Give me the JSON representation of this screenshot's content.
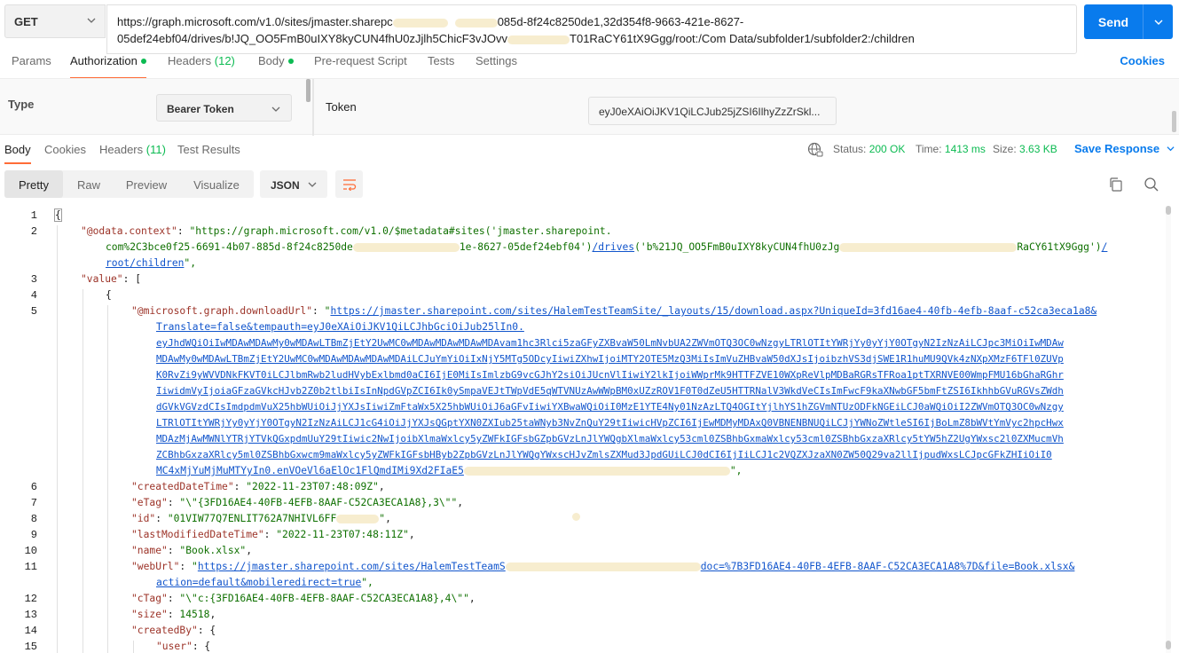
{
  "request": {
    "method": "GET",
    "url_line1": "https://graph.microsoft.com/v1.0/sites/jmaster.sharepc",
    "url_line1_b": "085d-8f24c8250de1,32d354f8-9663-421e-8627-",
    "url_line2": "05def24ebf04/drives/b!JQ_OO5FmB0uIXY8kyCUN4fhU0zJjlh5ChicF3vJOvv",
    "url_line2_b": "T01RaCY61tX9Ggg/root:/Com Data/subfolder1/subfolder2:/children",
    "send_label": "Send"
  },
  "request_tabs": {
    "params": "Params",
    "authorization": "Authorization",
    "headers": "Headers",
    "headers_count": "(12)",
    "body": "Body",
    "prerequest": "Pre-request Script",
    "tests": "Tests",
    "settings": "Settings",
    "cookies": "Cookies"
  },
  "auth": {
    "type_label": "Type",
    "type_value": "Bearer Token",
    "token_label": "Token",
    "token_value": "eyJ0eXAiOiJKV1QiLCJub25jZSI6IlhyZzZrSkl..."
  },
  "response_tabs": {
    "body": "Body",
    "cookies": "Cookies",
    "headers": "Headers",
    "headers_count": "(11)",
    "test_results": "Test Results"
  },
  "response_status": {
    "status_label": "Status:",
    "status_value": "200 OK",
    "time_label": "Time:",
    "time_value": "1413 ms",
    "size_label": "Size:",
    "size_value": "3.63 KB",
    "save_response": "Save Response"
  },
  "format": {
    "pretty": "Pretty",
    "raw": "Raw",
    "preview": "Preview",
    "visualize": "Visualize",
    "json": "JSON"
  },
  "code": {
    "line_numbers": [
      "1",
      "2",
      "3",
      "4",
      "5",
      "6",
      "7",
      "8",
      "9",
      "10",
      "11",
      "12",
      "13",
      "14",
      "15"
    ],
    "l1": "{",
    "l2_key": "\"@odata.context\"",
    "l2_val_a": "\"https://graph.microsoft.com/v1.0/$metadata#sites('jmaster.sharepoint.",
    "l2_val_b": "com%2C3bce0f25-6691-4b07-885d-8f24c8250de",
    "l2_val_b2": "1e-8627-05def24ebf04')",
    "l2_link1": "/drives",
    "l2_val_b3": "('b%21JQ_OO5FmB0uIXY8kyCUN4fhU0zJg",
    "l2_val_b4": "RaCY61tX9Ggg')",
    "l2_link2": "/",
    "l2_link3": "root/children",
    "l2_tail": "\",",
    "l3_key": "\"value\"",
    "l3_rest": ": [",
    "l4": "{",
    "l5_key": "\"@microsoft.graph.downloadUrl\"",
    "l5_lines": [
      "https://jmaster.sharepoint.com/sites/HalemTestTeamSite/_layouts/15/download.aspx?UniqueId=3fd16ae4-40fb-4efb-8aaf-c52ca3eca1a8&",
      "Translate=false&tempauth=eyJ0eXAiOiJKV1QiLCJhbGciOiJub25lIn0.",
      "eyJhdWQiOiIwMDAwMDAwMy0wMDAwLTBmZjEtY2UwMC0wMDAwMDAwMDAwMDAvam1hc3Rlci5zaGFyZXBvaW50LmNvbUA2ZWVmOTQ3OC0wNzgyLTRlOTItYWRjYy0yYjY0OTgyN2IzNzAiLCJpc3MiOiIwMDAw",
      "MDAwMy0wMDAwLTBmZjEtY2UwMC0wMDAwMDAwMDAwMDAiLCJuYmYiOiIxNjY5MTg5ODcyIiwiZXhwIjoiMTY2OTE5MzQ3MiIsImVuZHBvaW50dXJsIjoibzhVS3djSWE1R1huMU9QVk4zNXpXMzF6TFl0ZUVp",
      "K0RvZi9yWVVDNkFKVT0iLCJlbmRwb2ludHVybExlbmd0aCI6IjE0MiIsImlzbG9vcGJhY2siOiJUcnVlIiwiY2lkIjoiWWprMk9HTTFZVE10WXpReVlpMDBaRGRsTFRoa1ptTXRNVE00WmpFMU16bGhaRGhr",
      "IiwidmVyIjoiaGFzaGVkcHJvb2Z0b2tlbiIsInNpdGVpZCI6Ik0ySmpaVEJtTWpVdE5qWTVNUzAwWWpBM0xUZzROV1F0T0dZeU5HTTRNalV3WkdVeCIsImFwcF9kaXNwbGF5bmFtZSI6IkhhbGVuRGVsZWdh",
      "dGVkVGVzdCIsImdpdmVuX25hbWUiOiJjYXJsIiwiZmFtaWx5X25hbWUiOiJ6aGFvIiwiYXBwaWQiOiI0MzE1YTE4Ny01NzAzLTQ4OGItYjlhYS1hZGVmNTUzODFkNGEiLCJ0aWQiOiI2ZWVmOTQ3OC0wNzgy",
      "LTRlOTItYWRjYy0yYjY0OTgyN2IzNzAiLCJ1cG4iOiJjYXJsQGptYXN0ZXIub25taWNyb3NvZnQuY29tIiwicHVpZCI6IjEwMDMyMDAxQ0VBNENBNUQiLCJjYWNoZWtleSI6IjBoLmZ8bWVtYmVyc2hpcHwx",
      "MDAzMjAwMWNlYTRjYTVkQGxpdmUuY29tIiwic2NwIjoibXlmaWxlcy5yZWFkIGFsbGZpbGVzLnJlYWQgbXlmaWxlcy53cml0ZSBhbGxmaWxlcy53cml0ZSBhbGxzaXRlcy5tYW5hZ2UgYWxsc2l0ZXMucmVh",
      "ZCBhbGxzaXRlcy5ml0ZSBhbGxwcm9maWxlcy5yZWFkIGFsbHByb2ZpbGVzLnJlYWQgYWxscHJvZmlsZXMud3JpdGUiLCJ0dCI6IjIiLCJ1c2VQZXJzaXN0ZW50Q29va2llIjpudWxsLCJpcGFkZHIiOiI0",
      "MC4xMjYuMjMuMTYyIn0.enVOeVl6aElOc1FlQmdIMi9Xd2FIaE5"
    ],
    "l5_tail": "\",",
    "l6_key": "\"createdDateTime\"",
    "l6_val": "\"2022-11-23T07:48:09Z\"",
    "l7_key": "\"eTag\"",
    "l7_val": "\"\\\"{3FD16AE4-40FB-4EFB-8AAF-C52CA3ECA1A8},3\\\"\"",
    "l8_key": "\"id\"",
    "l8_val": "\"01VIW77Q7ENLIT762A7NHIVL6FF",
    "l8_tail": "\"",
    "l9_key": "\"lastModifiedDateTime\"",
    "l9_val": "\"2022-11-23T07:48:11Z\"",
    "l10_key": "\"name\"",
    "l10_val": "\"Book.xlsx\"",
    "l11_key": "\"webUrl\"",
    "l11_link_a": "https://jmaster.sharepoint.com/sites/HalemTestTeamS",
    "l11_link_b": "doc=%7B3FD16AE4-40FB-4EFB-8AAF-C52CA3ECA1A8%7D&file=Book.xlsx&",
    "l11_link_c": "action=default&mobileredirect=true",
    "l11_tail": "\",",
    "l12_key": "\"cTag\"",
    "l12_val": "\"\\\"c:{3FD16AE4-40FB-4EFB-8AAF-C52CA3ECA1A8},4\\\"\"",
    "l13_key": "\"size\"",
    "l13_val": "14518",
    "l14_key": "\"createdBy\"",
    "l14_rest": ": {",
    "l15_key": "\"user\"",
    "l15_rest": ": {"
  }
}
